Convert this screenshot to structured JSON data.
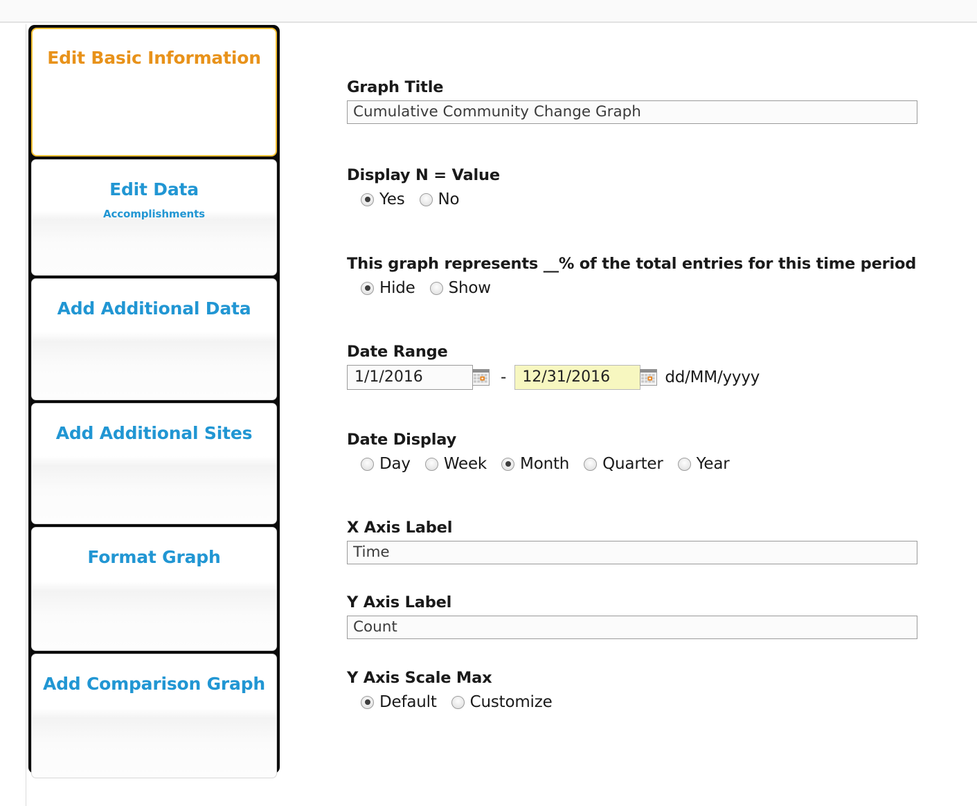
{
  "sidebar": {
    "tabs": [
      {
        "title": "Edit Basic Information",
        "subtitle": "",
        "active": true
      },
      {
        "title": "Edit Data",
        "subtitle": "Accomplishments",
        "active": false
      },
      {
        "title": "Add Additional Data",
        "subtitle": "",
        "active": false
      },
      {
        "title": "Add Additional Sites",
        "subtitle": "",
        "active": false
      },
      {
        "title": "Format Graph",
        "subtitle": "",
        "active": false
      },
      {
        "title": "Add Comparison Graph",
        "subtitle": "",
        "active": false
      }
    ],
    "active_color": "#e8921a",
    "inactive_color": "#2196d3",
    "active_border_color": "#f5c032"
  },
  "form": {
    "graph_title": {
      "label": "Graph Title",
      "value": "Cumulative Community Change Graph"
    },
    "display_n_value": {
      "label": "Display N = Value",
      "options": [
        "Yes",
        "No"
      ],
      "selected": "Yes"
    },
    "percent_total": {
      "label": "This graph represents __% of the total entries for this time period",
      "options": [
        "Hide",
        "Show"
      ],
      "selected": "Hide"
    },
    "date_range": {
      "label": "Date Range",
      "start": "1/1/2016",
      "end": "12/31/2016",
      "separator": "-",
      "format_hint": "dd/MM/yyyy",
      "calendar_icon": "calendar-icon",
      "highlight_color": "#f7f7c0"
    },
    "date_display": {
      "label": "Date Display",
      "options": [
        "Day",
        "Week",
        "Month",
        "Quarter",
        "Year"
      ],
      "selected": "Month"
    },
    "x_axis_label": {
      "label": "X Axis Label",
      "value": "Time"
    },
    "y_axis_label": {
      "label": "Y Axis Label",
      "value": "Count"
    },
    "y_axis_scale_max": {
      "label": "Y Axis Scale Max",
      "options": [
        "Default",
        "Customize"
      ],
      "selected": "Default"
    }
  }
}
